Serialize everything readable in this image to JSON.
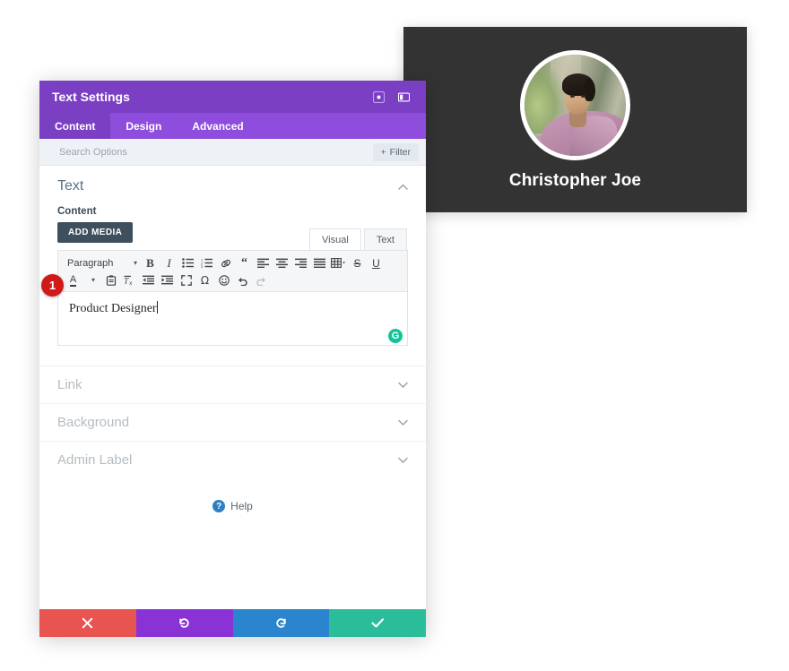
{
  "preview": {
    "name": "Christopher Joe",
    "role": "Product Designer",
    "avatar_icon": "user-photo",
    "bg_color": "#333333"
  },
  "modal": {
    "title": "Text Settings",
    "header_icons": [
      {
        "name": "expand-icon",
        "glyph": "expand"
      },
      {
        "name": "layout-icon",
        "glyph": "layout"
      }
    ],
    "tabs": [
      {
        "label": "Content",
        "active": true
      },
      {
        "label": "Design",
        "active": false
      },
      {
        "label": "Advanced",
        "active": false
      }
    ],
    "search": {
      "placeholder": "Search Options",
      "value": ""
    },
    "filter_button": {
      "label": "Filter",
      "icon": "plus-icon"
    },
    "text_section": {
      "title": "Text",
      "chevron": "chevron-up-icon",
      "content_label": "Content",
      "add_media_label": "ADD MEDIA"
    },
    "editor": {
      "tabs": [
        {
          "label": "Visual",
          "active": true
        },
        {
          "label": "Text",
          "active": false
        }
      ],
      "paragraph_select": "Paragraph",
      "toolbar_row1": [
        {
          "name": "bold-icon",
          "glyph": "B",
          "dim": false
        },
        {
          "name": "italic-icon",
          "glyph": "I",
          "dim": false
        },
        {
          "name": "bulleted-list-icon",
          "glyph": "ul",
          "dim": false
        },
        {
          "name": "numbered-list-icon",
          "glyph": "ol",
          "dim": false
        },
        {
          "name": "link-icon",
          "glyph": "link",
          "dim": false
        },
        {
          "name": "blockquote-icon",
          "glyph": "quote",
          "dim": false
        },
        {
          "name": "align-left-icon",
          "glyph": "alignl",
          "dim": false
        },
        {
          "name": "align-center-icon",
          "glyph": "alignc",
          "dim": false
        },
        {
          "name": "align-right-icon",
          "glyph": "alignr",
          "dim": false
        },
        {
          "name": "align-justify-icon",
          "glyph": "alignj",
          "dim": false
        },
        {
          "name": "table-icon",
          "glyph": "table",
          "dim": false
        },
        {
          "name": "strikethrough-icon",
          "glyph": "S",
          "dim": false
        },
        {
          "name": "underline-icon",
          "glyph": "U",
          "dim": false
        }
      ],
      "toolbar_row2": [
        {
          "name": "text-color-icon",
          "glyph": "A",
          "dim": false
        },
        {
          "name": "paste-icon",
          "glyph": "paste",
          "dim": false
        },
        {
          "name": "clear-formatting-icon",
          "glyph": "Tx",
          "dim": false
        },
        {
          "name": "outdent-icon",
          "glyph": "outdent",
          "dim": false
        },
        {
          "name": "indent-icon",
          "glyph": "indent",
          "dim": false
        },
        {
          "name": "fullscreen-icon",
          "glyph": "fullscreen",
          "dim": false
        },
        {
          "name": "special-character-icon",
          "glyph": "omega",
          "dim": false
        },
        {
          "name": "emoji-icon",
          "glyph": "smiley",
          "dim": false
        },
        {
          "name": "undo-icon",
          "glyph": "undo",
          "dim": false
        },
        {
          "name": "redo-icon",
          "glyph": "redo",
          "dim": true
        }
      ],
      "text_value": "Product Designer",
      "grammarly_badge": "G"
    },
    "step_badge": "1",
    "collapsed_sections": [
      {
        "label": "Link",
        "chevron": "chevron-down-icon"
      },
      {
        "label": "Background",
        "chevron": "chevron-down-icon"
      },
      {
        "label": "Admin Label",
        "chevron": "chevron-down-icon"
      }
    ],
    "help": {
      "label": "Help",
      "icon": "question-mark-icon"
    },
    "footer_buttons": [
      {
        "name": "cancel-button",
        "icon": "close-icon",
        "color": "#e8544f"
      },
      {
        "name": "undo-button",
        "icon": "undo-icon",
        "color": "#8932d6"
      },
      {
        "name": "redo-button",
        "icon": "redo-icon",
        "color": "#2a84ce"
      },
      {
        "name": "save-button",
        "icon": "check-icon",
        "color": "#2bbd9a"
      }
    ]
  }
}
